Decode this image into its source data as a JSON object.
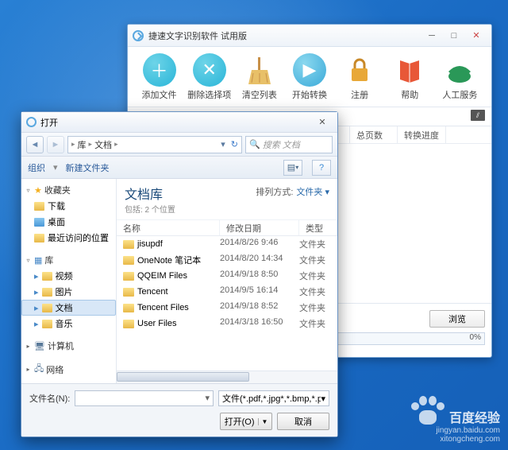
{
  "mainwin": {
    "title": "捷速文字识别软件 试用版",
    "toolbar": [
      {
        "label": "添加文件",
        "icon": "add"
      },
      {
        "label": "删除选择项",
        "icon": "del"
      },
      {
        "label": "清空列表",
        "icon": "clear"
      },
      {
        "label": "开始转换",
        "icon": "play"
      },
      {
        "label": "注册",
        "icon": "lock"
      },
      {
        "label": "帮助",
        "icon": "help"
      },
      {
        "label": "人工服务",
        "icon": "phone"
      }
    ],
    "columns": {
      "c_pages": "总页数",
      "c_progress": "转换进度"
    },
    "browse_btn": "浏览",
    "progress_pct": "0%"
  },
  "openwin": {
    "title": "打开",
    "breadcrumb": {
      "seg1": "库",
      "seg2": "文档"
    },
    "search_placeholder": "搜索 文档",
    "toolbar": {
      "organize": "组织",
      "newfolder": "新建文件夹"
    },
    "tree": {
      "favorites": "收藏夹",
      "fav_items": [
        "下载",
        "桌面",
        "最近访问的位置"
      ],
      "libraries": "库",
      "lib_items": [
        "视频",
        "图片",
        "文档",
        "音乐"
      ],
      "computer": "计算机",
      "network": "网络"
    },
    "panel": {
      "heading": "文档库",
      "subheading": "包括: 2 个位置",
      "sort_label": "排列方式:",
      "sort_value": "文件夹"
    },
    "cols": {
      "name": "名称",
      "date": "修改日期",
      "type": "类型"
    },
    "rows": [
      {
        "name": "jisupdf",
        "date": "2014/8/26 9:46",
        "type": "文件夹"
      },
      {
        "name": "OneNote 笔记本",
        "date": "2014/8/20 14:34",
        "type": "文件夹"
      },
      {
        "name": "QQEIM Files",
        "date": "2014/9/18 8:50",
        "type": "文件夹"
      },
      {
        "name": "Tencent",
        "date": "2014/9/5 16:14",
        "type": "文件夹"
      },
      {
        "name": "Tencent Files",
        "date": "2014/9/18 8:52",
        "type": "文件夹"
      },
      {
        "name": "User Files",
        "date": "2014/3/18 16:50",
        "type": "文件夹"
      }
    ],
    "footer": {
      "filename_label": "文件名(N):",
      "filter": "文件(*.pdf,*.jpg*,*.bmp,*.png,*",
      "open_btn": "打开(O)",
      "cancel_btn": "取消"
    }
  },
  "watermark": {
    "line1": "百度经验",
    "line2": "jingyan.baidu.com",
    "line3": "xitongcheng.com"
  }
}
